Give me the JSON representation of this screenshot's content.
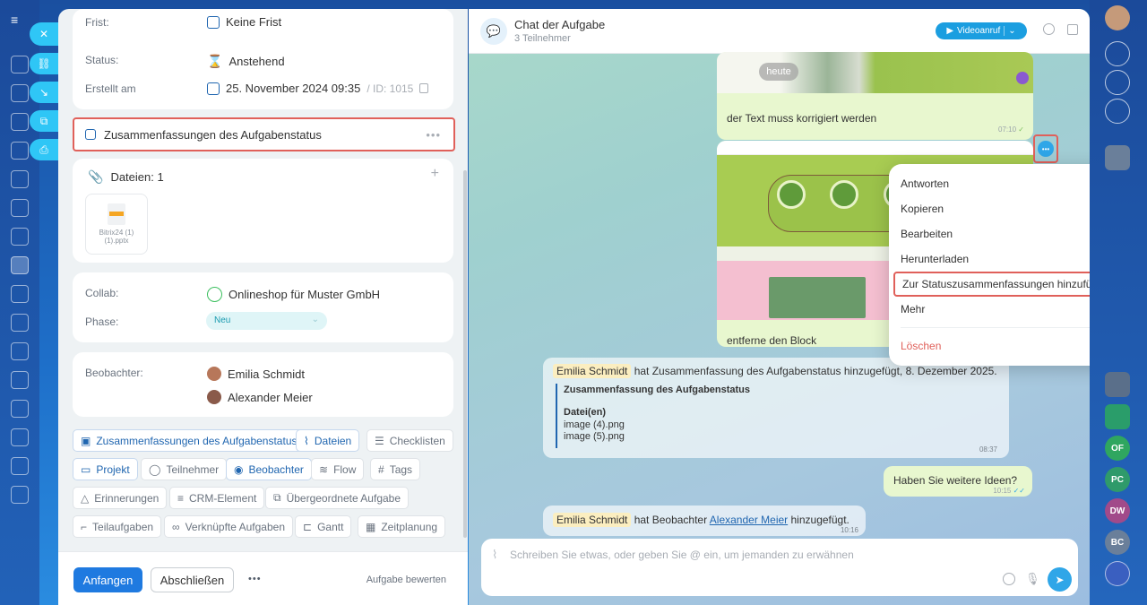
{
  "task": {
    "deadline_label": "Frist:",
    "deadline_value": "Keine Frist",
    "status_label": "Status:",
    "status_value": "Anstehend",
    "created_label": "Erstellt am",
    "created_value": "25. November 2024 09:35",
    "id_value": "/ ID: 1015",
    "summary_title": "Zusammenfassungen des Aufgabenstatus",
    "files_title": "Dateien: 1",
    "file_name": "Bitrix24 (1) (1).pptx",
    "collab_label": "Collab:",
    "collab_value": "Onlineshop für Muster GmbH",
    "phase_label": "Phase:",
    "phase_value": "Neu",
    "observers_label": "Beobachter:",
    "observers": [
      "Emilia Schmidt",
      "Alexander Meier"
    ],
    "tags": {
      "t1": "Zusammenfassungen des Aufgabenstatus",
      "t2": "Dateien",
      "t3": "Checklisten",
      "t4": "Projekt",
      "t5": "Teilnehmer",
      "t6": "Beobachter",
      "t7": "Flow",
      "t8": "Tags",
      "t9": "Erinnerungen",
      "t10": "CRM-Element",
      "t11": "Übergeordnete Aufgabe",
      "t12": "Teilaufgaben",
      "t13": "Verknüpfte Aufgaben",
      "t14": "Gantt",
      "t15": "Zeitplanung"
    },
    "start_button": "Anfangen",
    "complete_button": "Abschließen",
    "rate_link": "Aufgabe bewerten"
  },
  "chat": {
    "title": "Chat der Aufgabe",
    "subtitle": "3 Teilnehmer",
    "video_button": "Videoanruf",
    "msg1_text": "der Text muss korrigiert werden",
    "msg1_time": "07:10",
    "today_badge": "heute",
    "msg2_text": "entferne den Block",
    "sys1_name": "Emilia Schmidt",
    "sys1_text": "hat Zusammenfassung des Aufgabenstatus hinzugefügt, 8. Dezember 2025.",
    "sys1_quote_title": "Zusammenfassung des Aufgabenstatus",
    "sys1_files_label": "Datei(en)",
    "sys1_file1": "image (4).png",
    "sys1_file2": "image (5).png",
    "sys1_time": "08:37",
    "msg3_text": "Haben Sie weitere Ideen?",
    "msg3_time": "10:15",
    "sys2_name": "Emilia Schmidt",
    "sys2_text": "hat Beobachter",
    "sys2_link": "Alexander Meier",
    "sys2_tail": "hinzugefügt.",
    "sys2_time": "10:16",
    "input_placeholder": "Schreiben Sie etwas, oder geben Sie @ ein, um jemanden zu erwähnen"
  },
  "context_menu": {
    "reply": "Antworten",
    "copy": "Kopieren",
    "edit": "Bearbeiten",
    "download": "Herunterladen",
    "add_status": "Zur Statuszusammenfassungen hinzufügen",
    "more": "Mehr",
    "delete": "Löschen"
  },
  "rightrail": {
    "badges": [
      "OF",
      "PC",
      "DW",
      "BC"
    ]
  },
  "colors": {
    "accent": "#1f7ae0",
    "highlight_border": "#e0605a",
    "bubble": "#e8f7cf",
    "delete": "#e0605a"
  }
}
